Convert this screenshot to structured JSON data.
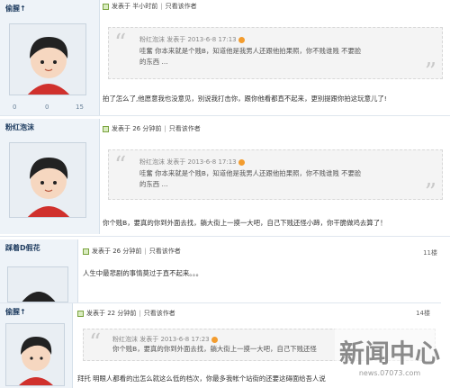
{
  "posts": [
    {
      "author": "偷腥↑",
      "stats": [
        "0",
        "0",
        "15"
      ],
      "time": "发表于 半小时前",
      "only": "只看该作者",
      "quote_head": "粉红泡沫 发表于 2013-6-8 17:13",
      "quote_lines": [
        "哇奮 你本来就是个贱B，知道他是我男人还跟他拍果照，你不贱谁贱 不要脸",
        "的东西 ..."
      ],
      "body": "拍了怎么了,他愿意我也没意见，别说我打击你，跟你他看都直不起来，更别提跟你拍这玩意儿了!"
    },
    {
      "author": "粉红泡沫",
      "time": "发表于 26 分钟前",
      "only": "只看该作者",
      "quote_head": "粉红泡沫 发表于 2013-6-8 17:13",
      "quote_lines": [
        "哇奮 你本来就是个贱B，知道他是我男人还跟他拍果照，你不贱谁贱 不要脸",
        "的东西 ..."
      ],
      "body": "你个贱B，要真的你到外面去找，躺大街上一摸一大吧，自己下贱还怪小蹄，你干脆做鸡去算了！"
    },
    {
      "author": "踩着D假花",
      "time": "发表于 26 分钟前",
      "only": "只看该作者",
      "floor": "11楼",
      "body": "人生中最悲剧的事情莫过于直不起来。。。"
    },
    {
      "author": "偷腥↑",
      "time": "发表于 22 分钟前",
      "only": "只看该作者",
      "floor": "14楼",
      "quote_head": "粉红泡沫 发表于 2013-6-8 17:23",
      "quote_lines": [
        "你个贱B，要真的你到外面去找，躺大街上一摸一大吧，自己下贱还怪",
        "..."
      ],
      "body": "拜托 明眼人都看的出怎么就这么低的档次，你最多我帐个站街的还要这碍面给吾人说"
    }
  ],
  "watermark": {
    "title": "新闻中心",
    "url": "news.07073.com"
  }
}
